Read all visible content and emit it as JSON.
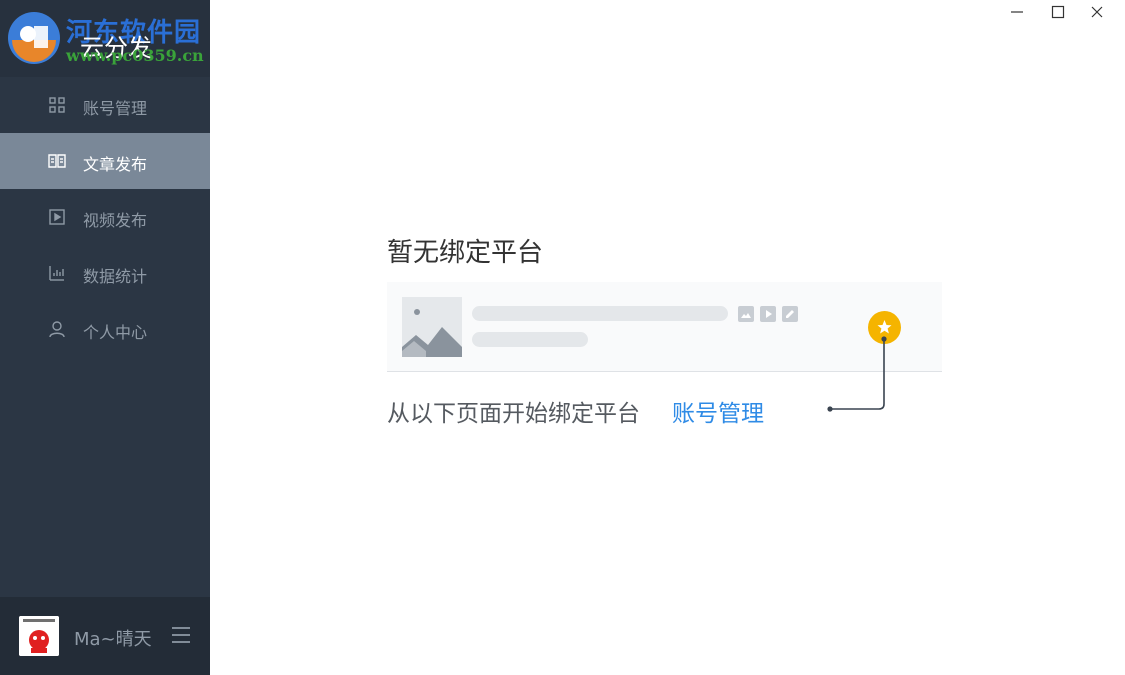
{
  "app": {
    "title": "云分发",
    "watermark": "河东软件园",
    "watermark_url": "www.pc0359.cn"
  },
  "sidebar": {
    "items": [
      {
        "label": "账号管理",
        "icon": "grid-icon",
        "active": false
      },
      {
        "label": "文章发布",
        "icon": "book-icon",
        "active": true
      },
      {
        "label": "视频发布",
        "icon": "play-icon",
        "active": false
      },
      {
        "label": "数据统计",
        "icon": "bar-chart-icon",
        "active": false
      },
      {
        "label": "个人中心",
        "icon": "user-icon",
        "active": false
      }
    ]
  },
  "user": {
    "name": "Ma~晴天"
  },
  "main": {
    "empty_title": "暂无绑定平台",
    "hint": "从以下页面开始绑定平台",
    "link": "账号管理"
  },
  "colors": {
    "sidebar_bg": "#2b3644",
    "active_item_bg": "#7a8898",
    "link": "#2f8be6",
    "star": "#f5b400"
  }
}
